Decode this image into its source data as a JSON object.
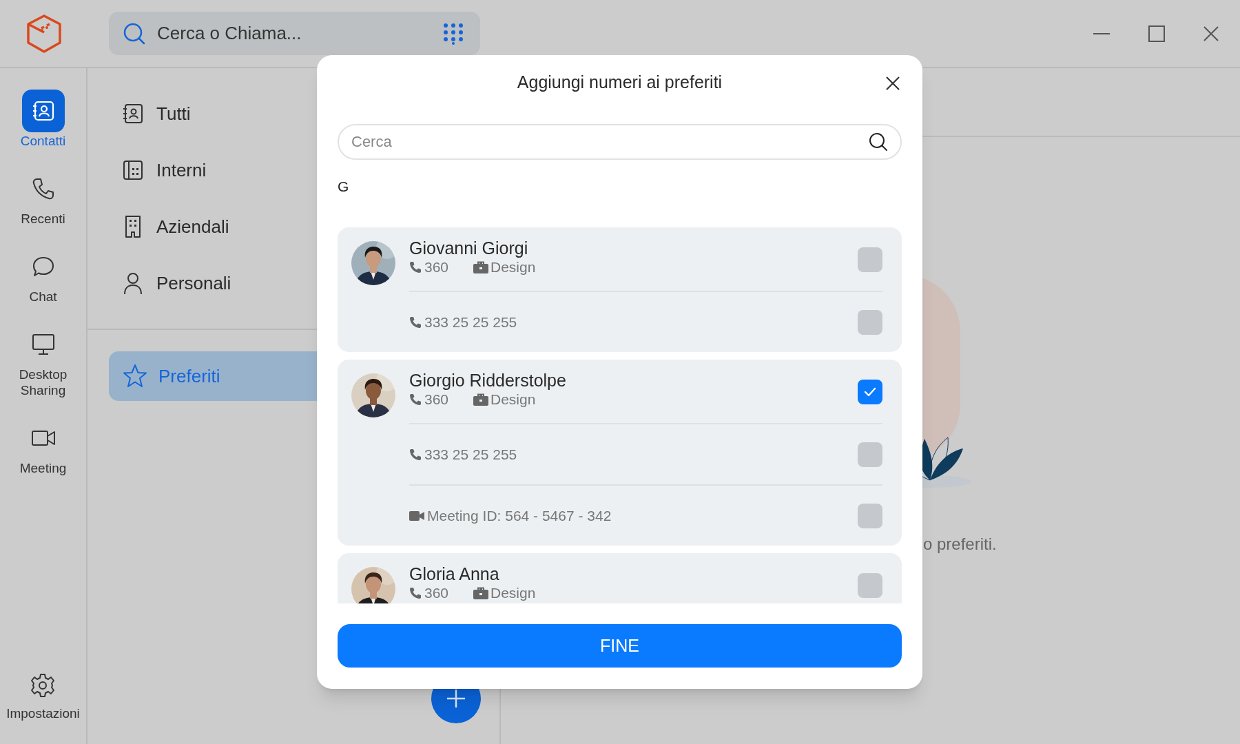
{
  "search": {
    "placeholder": "Cerca o Chiama..."
  },
  "rail": [
    {
      "label": "Contatti",
      "selected": true
    },
    {
      "label": "Recenti",
      "selected": false
    },
    {
      "label": "Chat",
      "selected": false
    },
    {
      "label": "Desktop Sharing",
      "selected": false
    },
    {
      "label": "Meeting",
      "selected": false
    }
  ],
  "settings": {
    "label": "Impostazioni"
  },
  "categories": [
    {
      "label": "Tutti",
      "selected": false
    },
    {
      "label": "Interni",
      "selected": false
    },
    {
      "label": "Aziendali",
      "selected": false
    },
    {
      "label": "Personali",
      "selected": false
    }
  ],
  "favorites": {
    "label": "Preferiti",
    "selected": true
  },
  "empty_state": {
    "text": "o preferiti."
  },
  "dialog": {
    "title": "Aggiungi numeri ai preferiti",
    "search": {
      "placeholder": "Cerca"
    },
    "section": "G",
    "contacts": [
      {
        "name": "Giovanni Giorgi",
        "extension": "360",
        "department": "Design",
        "selected": false,
        "numbers": [
          {
            "kind": "phone",
            "text": "333 25 25 255",
            "selected": false
          }
        ]
      },
      {
        "name": "Giorgio Ridderstolpe",
        "extension": "360",
        "department": "Design",
        "selected": true,
        "numbers": [
          {
            "kind": "phone",
            "text": "333 25 25 255",
            "selected": false
          },
          {
            "kind": "meeting",
            "text": "Meeting ID: 564 - 5467 - 342",
            "selected": false
          }
        ]
      },
      {
        "name": "Gloria Anna",
        "extension": "360",
        "department": "Design",
        "selected": false
      }
    ],
    "done": "FINE"
  }
}
